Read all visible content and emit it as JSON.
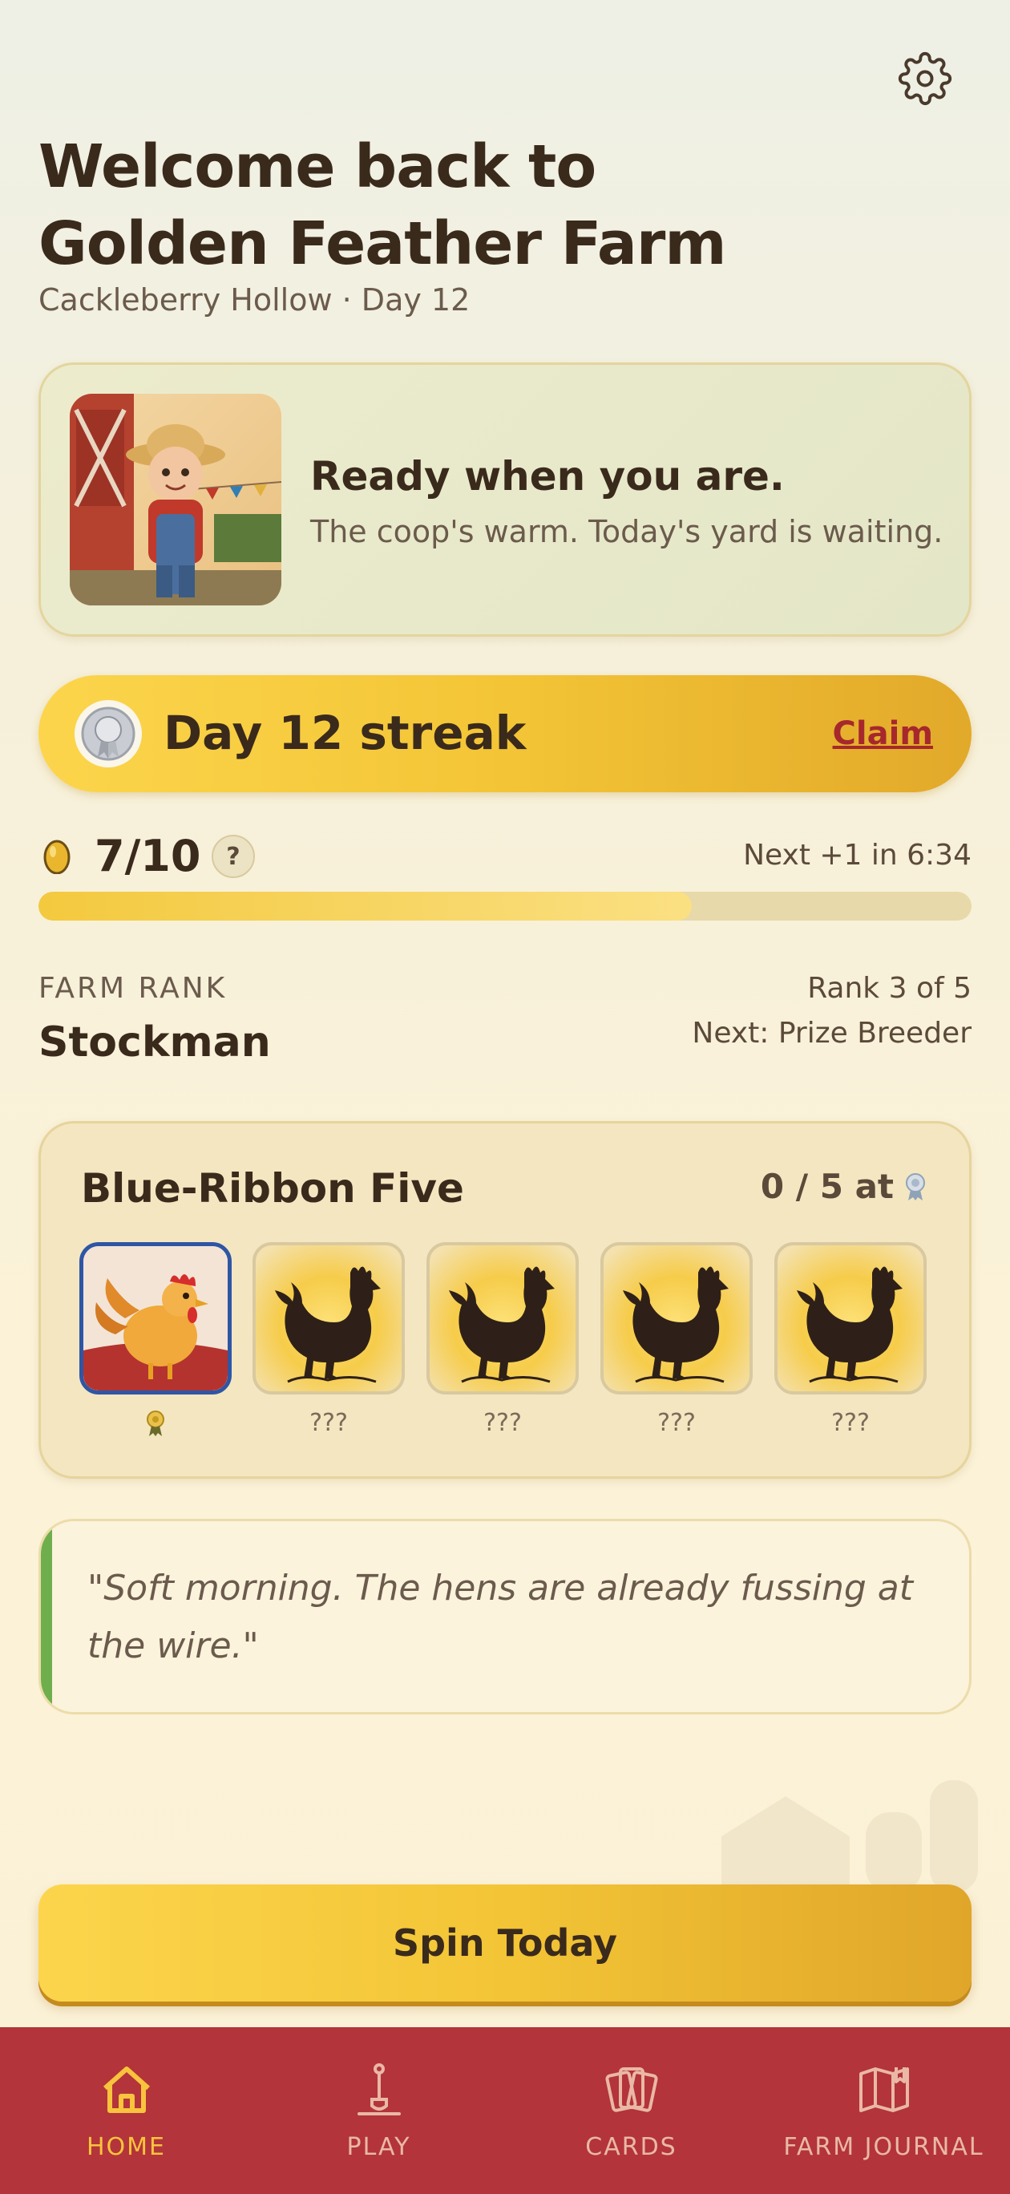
{
  "header": {
    "title": "Welcome back to Golden Feather Farm",
    "subtitle": "Cackleberry Hollow · Day 12"
  },
  "hero": {
    "heading": "Ready when you are.",
    "message": "The coop's warm. Today's yard is waiting."
  },
  "streak": {
    "label": "Day 12 streak",
    "claim_label": "Claim"
  },
  "eggs": {
    "count": "7/10",
    "current": 7,
    "max": 10,
    "help_label": "?",
    "next_label": "Next +1 in 6:34"
  },
  "rank": {
    "heading": "FARM RANK",
    "name": "Stockman",
    "position": "Rank 3 of 5",
    "next": "Next: Prize Breeder"
  },
  "collection": {
    "title": "Blue-Ribbon Five",
    "count": "0 / 5 at",
    "cards": [
      {
        "caption": "",
        "state": "owned"
      },
      {
        "caption": "???",
        "state": "locked"
      },
      {
        "caption": "???",
        "state": "locked"
      },
      {
        "caption": "???",
        "state": "locked"
      },
      {
        "caption": "???",
        "state": "locked"
      }
    ]
  },
  "quote": {
    "text": "\"Soft morning. The hens are already fussing at the wire.\""
  },
  "spin_button": {
    "label": "Spin Today"
  },
  "nav": {
    "items": [
      {
        "label": "HOME",
        "icon": "house-icon",
        "active": true
      },
      {
        "label": "PLAY",
        "icon": "shovel-icon",
        "active": false
      },
      {
        "label": "CARDS",
        "icon": "cards-icon",
        "active": false
      },
      {
        "label": "FARM JOURNAL",
        "icon": "journal-icon",
        "active": false
      }
    ]
  },
  "colors": {
    "accent_gold": "#f3c536",
    "nav_red": "#b3343a",
    "claim_red": "#a6282c",
    "quote_green": "#6fae4c",
    "text_dark": "#3a2a1c"
  }
}
